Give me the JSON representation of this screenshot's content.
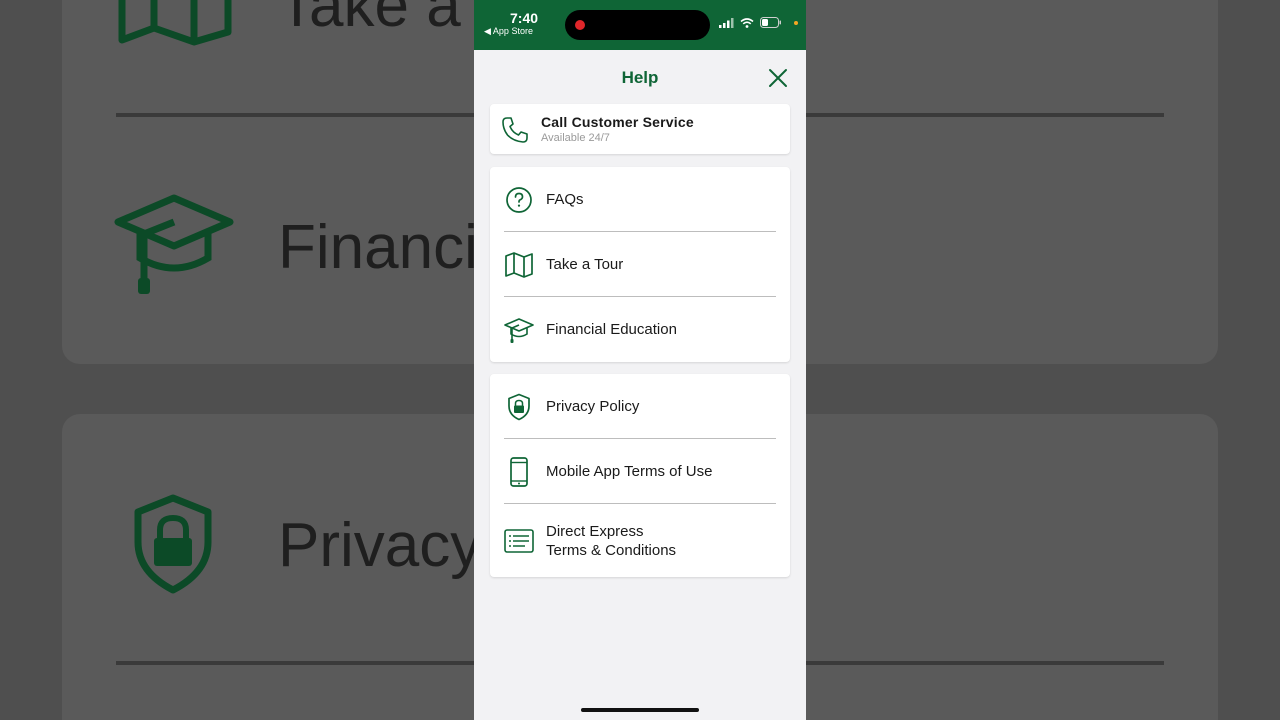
{
  "status_bar": {
    "time": "7:40",
    "back_app": "◀ App Store"
  },
  "header": {
    "title": "Help"
  },
  "call_card": {
    "label": "Call Customer Service",
    "sublabel": "Available 24/7",
    "icon": "phone-icon"
  },
  "menu_groups": [
    {
      "items": [
        {
          "label": "FAQs",
          "icon": "question-circle-icon"
        },
        {
          "label": "Take a Tour",
          "icon": "map-icon"
        },
        {
          "label": "Financial Education",
          "icon": "graduation-cap-icon"
        }
      ]
    },
    {
      "items": [
        {
          "label": "Privacy Policy",
          "icon": "shield-lock-icon"
        },
        {
          "label": "Mobile App Terms of Use",
          "icon": "mobile-phone-icon"
        },
        {
          "label_line1": "Direct Express",
          "label_line2": "Terms & Conditions",
          "icon": "document-list-icon"
        }
      ]
    }
  ],
  "background": {
    "text_1": "Take a T",
    "text_2": "Financia",
    "text_3": "Privacy"
  },
  "colors": {
    "brand_green": "#0f6536",
    "page_bg": "#f2f2f4",
    "card_bg": "#ffffff",
    "text_primary": "#1a1a1a",
    "text_secondary": "#9a9a9a",
    "recording_red": "#e0262a"
  }
}
